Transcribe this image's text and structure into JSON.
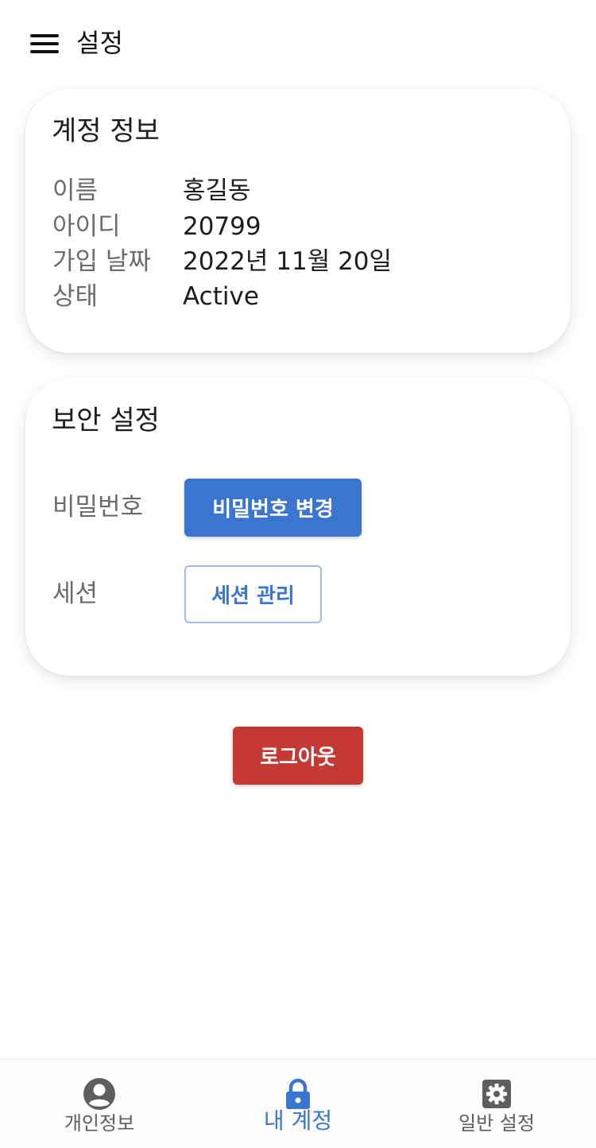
{
  "app_bar": {
    "title": "설정",
    "menu_icon": "hamburger-menu-icon"
  },
  "account_card": {
    "title": "계정 정보",
    "rows": [
      {
        "label": "이름",
        "value": "홍길동"
      },
      {
        "label": "아이디",
        "value": "20799"
      },
      {
        "label": "가입 날짜",
        "value": "2022년 11월 20일"
      },
      {
        "label": "상태",
        "value": "Active"
      }
    ]
  },
  "security_card": {
    "title": "보안 설정",
    "password_label": "비밀번호",
    "password_button": "비밀번호 변경",
    "session_label": "세션",
    "session_button": "세션 관리"
  },
  "logout_button": "로그아웃",
  "colors": {
    "primary": "#3a75cf",
    "danger": "#c43a33",
    "muted_text": "#6b6b6b"
  },
  "bottom_nav": {
    "items": [
      {
        "label": "개인정보",
        "icon": "account-circle-icon",
        "active": false
      },
      {
        "label": "내 계정",
        "icon": "lock-icon",
        "active": true
      },
      {
        "label": "일반 설정",
        "icon": "gear-icon",
        "active": false
      }
    ]
  }
}
